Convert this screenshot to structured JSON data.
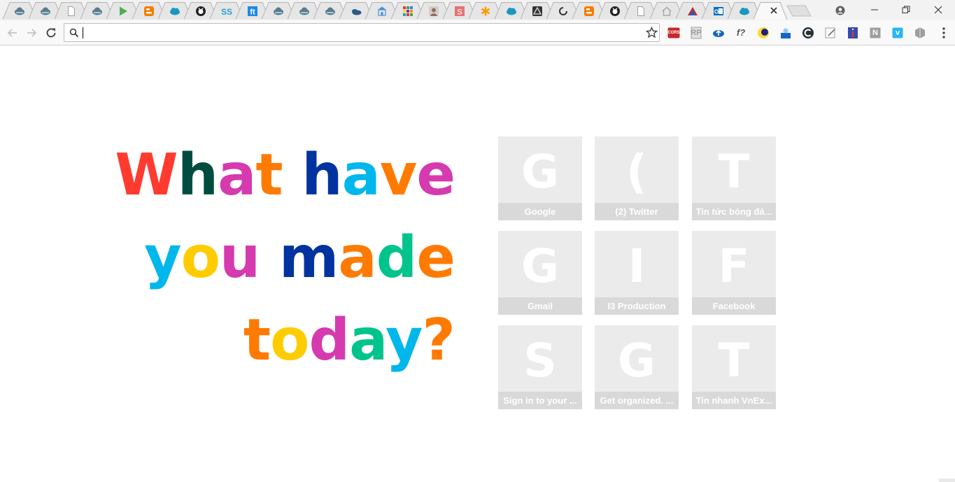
{
  "tabs": [
    {
      "icon": "cloud-dark-icon",
      "color": "#5b7b8c"
    },
    {
      "icon": "cloud-dark-icon",
      "color": "#5b7b8c"
    },
    {
      "icon": "blank-page-icon",
      "color": "#9e9e9e"
    },
    {
      "icon": "cloud-dark-icon",
      "color": "#5b7b8c"
    },
    {
      "icon": "play-store-icon",
      "color": "#4caf50"
    },
    {
      "icon": "blogger-icon",
      "color": "#f57d00"
    },
    {
      "icon": "salesforce-icon",
      "color": "#1798c1"
    },
    {
      "icon": "github-icon",
      "color": "#222222"
    },
    {
      "icon": "ss-icon",
      "color": "#2a9fd6"
    },
    {
      "icon": "ft-icon",
      "color": "#1e88e5"
    },
    {
      "icon": "cloud-dark-icon",
      "color": "#5b7b8c"
    },
    {
      "icon": "cloud-dark-icon",
      "color": "#5b7b8c"
    },
    {
      "icon": "cloud-dark-icon",
      "color": "#5b7b8c"
    },
    {
      "icon": "onedrive-icon",
      "color": "#2b5b84"
    },
    {
      "icon": "building-icon",
      "color": "#4a90d9"
    },
    {
      "icon": "grid-apps-icon",
      "color": "#e53935"
    },
    {
      "icon": "avatar-icon",
      "color": "#8d6e63"
    },
    {
      "icon": "s-square-icon",
      "color": "#e57373"
    },
    {
      "icon": "asterisk-icon",
      "color": "#ff9800"
    },
    {
      "icon": "salesforce-icon",
      "color": "#1798c1"
    },
    {
      "icon": "unity-icon",
      "color": "#333333"
    },
    {
      "icon": "circle-loader-icon",
      "color": "#333333"
    },
    {
      "icon": "blogger-icon",
      "color": "#f57d00"
    },
    {
      "icon": "github-icon",
      "color": "#222222"
    },
    {
      "icon": "blank-page-icon",
      "color": "#9e9e9e"
    },
    {
      "icon": "home-icon",
      "color": "#9e9e9e"
    },
    {
      "icon": "triangle-logo-icon",
      "color": "#c62828"
    },
    {
      "icon": "outlook-icon",
      "color": "#0072c6"
    },
    {
      "icon": "salesforce-icon",
      "color": "#1798c1"
    }
  ],
  "active_tab_index": 29,
  "omnibox": {
    "value": "",
    "placeholder": ""
  },
  "extensions": [
    {
      "icon": "cors-extension-icon",
      "label": "CORS",
      "color": "#c62828"
    },
    {
      "icon": "rp-extension-icon",
      "label": "RP",
      "color": "#9e9e9e"
    },
    {
      "icon": "cloud-upload-extension-icon",
      "label": "",
      "color": "#1565c0"
    },
    {
      "icon": "function-extension-icon",
      "label": "f?",
      "color": "#555555"
    },
    {
      "icon": "moon-extension-icon",
      "label": "",
      "color": "#fdd835"
    },
    {
      "icon": "user-extension-icon",
      "label": "",
      "color": "#1565c0"
    },
    {
      "icon": "c-extension-icon",
      "label": "",
      "color": "#263238"
    },
    {
      "icon": "note-extension-icon",
      "label": "",
      "color": "#9e9e9e"
    },
    {
      "icon": "info-extension-icon",
      "label": "",
      "color": "#3949ab"
    },
    {
      "icon": "n-extension-icon",
      "label": "N",
      "color": "#9e9e9e"
    },
    {
      "icon": "v-extension-icon",
      "label": "v",
      "color": "#29b6f6"
    },
    {
      "icon": "hex-extension-icon",
      "label": "",
      "color": "#9e9e9e"
    }
  ],
  "headline": {
    "lines": [
      [
        {
          "ch": "W",
          "color": "#ff3b30"
        },
        {
          "ch": "h",
          "color": "#004d40"
        },
        {
          "ch": "a",
          "color": "#d63aaf"
        },
        {
          "ch": "t",
          "color": "#ff7a00"
        },
        {
          "ch": " ",
          "color": "#000000"
        },
        {
          "ch": "h",
          "color": "#0033a0"
        },
        {
          "ch": "a",
          "color": "#00b7eb"
        },
        {
          "ch": "v",
          "color": "#ff7a00"
        },
        {
          "ch": "e",
          "color": "#d63aaf"
        }
      ],
      [
        {
          "ch": "y",
          "color": "#00b7eb"
        },
        {
          "ch": "o",
          "color": "#ffcc00"
        },
        {
          "ch": "u",
          "color": "#d63aaf"
        },
        {
          "ch": " ",
          "color": "#000000"
        },
        {
          "ch": "m",
          "color": "#0033a0"
        },
        {
          "ch": "a",
          "color": "#ff7a00"
        },
        {
          "ch": "d",
          "color": "#00c48c"
        },
        {
          "ch": "e",
          "color": "#ff7a00"
        }
      ],
      [
        {
          "ch": "t",
          "color": "#ff7a00"
        },
        {
          "ch": "o",
          "color": "#ffcc00"
        },
        {
          "ch": "d",
          "color": "#d63aaf"
        },
        {
          "ch": "a",
          "color": "#00c48c"
        },
        {
          "ch": "y",
          "color": "#00b7eb"
        },
        {
          "ch": "?",
          "color": "#ff7a00"
        }
      ]
    ]
  },
  "tiles": [
    {
      "letter": "G",
      "title": "Google"
    },
    {
      "letter": "(",
      "title": "(2) Twitter"
    },
    {
      "letter": "T",
      "title": "Tin tức bóng đá..."
    },
    {
      "letter": "G",
      "title": "Gmail"
    },
    {
      "letter": "I",
      "title": "I3 Production"
    },
    {
      "letter": "F",
      "title": "Facebook"
    },
    {
      "letter": "S",
      "title": "Sign in to your ..."
    },
    {
      "letter": "G",
      "title": "Get organized. ..."
    },
    {
      "letter": "T",
      "title": "Tin nhanh VnEx..."
    }
  ]
}
